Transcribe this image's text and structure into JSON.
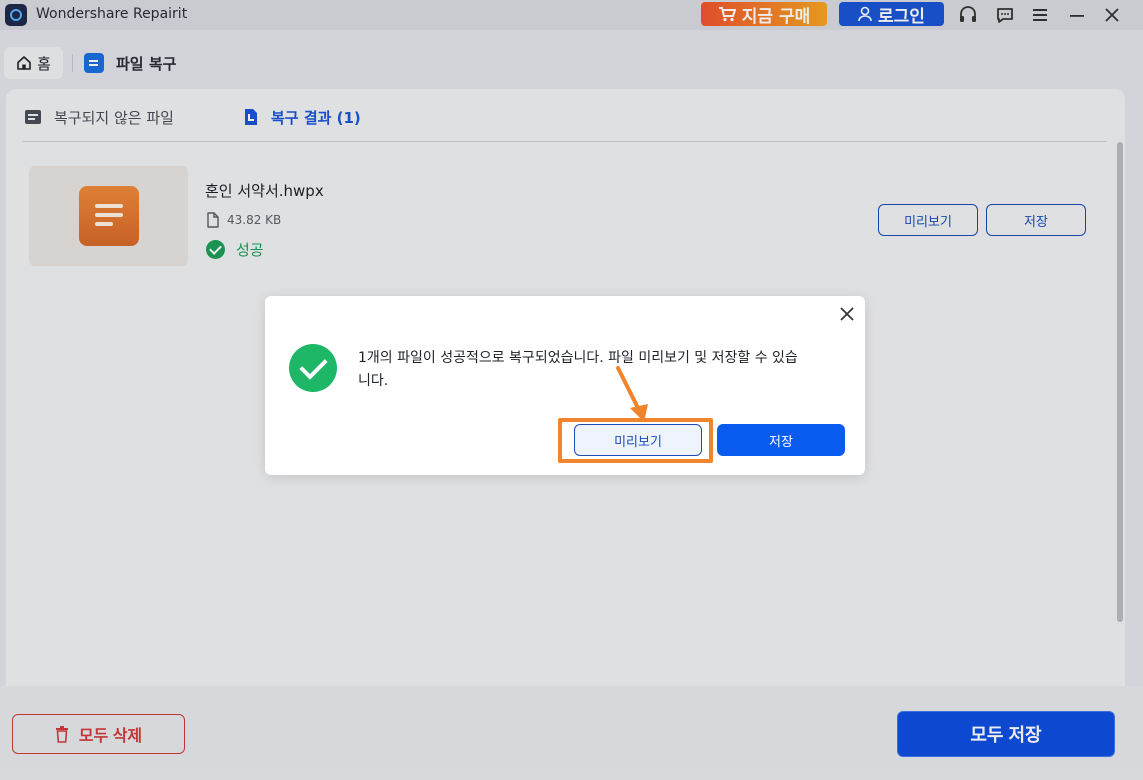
{
  "app": {
    "title": "Wondershare Repairit"
  },
  "titlebar": {
    "buy_label": "지금 구매",
    "login_label": "로그인",
    "icons": [
      "headset-icon",
      "chat-icon",
      "menu-icon",
      "minimize-icon",
      "close-icon"
    ]
  },
  "nav": {
    "home_label": "홈",
    "current_label": "파일 복구"
  },
  "tabs": {
    "unrecovered_label": "복구되지 않은 파일",
    "results_label": "복구 결과 (1)"
  },
  "file": {
    "name": "혼인 서약서.hwpx",
    "size": "43.82 KB",
    "status": "성공",
    "preview_label": "미리보기",
    "save_label": "저장"
  },
  "dialog": {
    "message": "1개의 파일이 성공적으로 복구되었습니다. 파일 미리보기 및 저장할 수 있습니다.",
    "preview_label": "미리보기",
    "save_label": "저장"
  },
  "footer": {
    "delete_all_label": "모두 삭제",
    "save_all_label": "모두 저장"
  },
  "colors": {
    "accent": "#0a5cf0",
    "success": "#1db767",
    "danger": "#d23b3b",
    "highlight": "#f0852d"
  }
}
